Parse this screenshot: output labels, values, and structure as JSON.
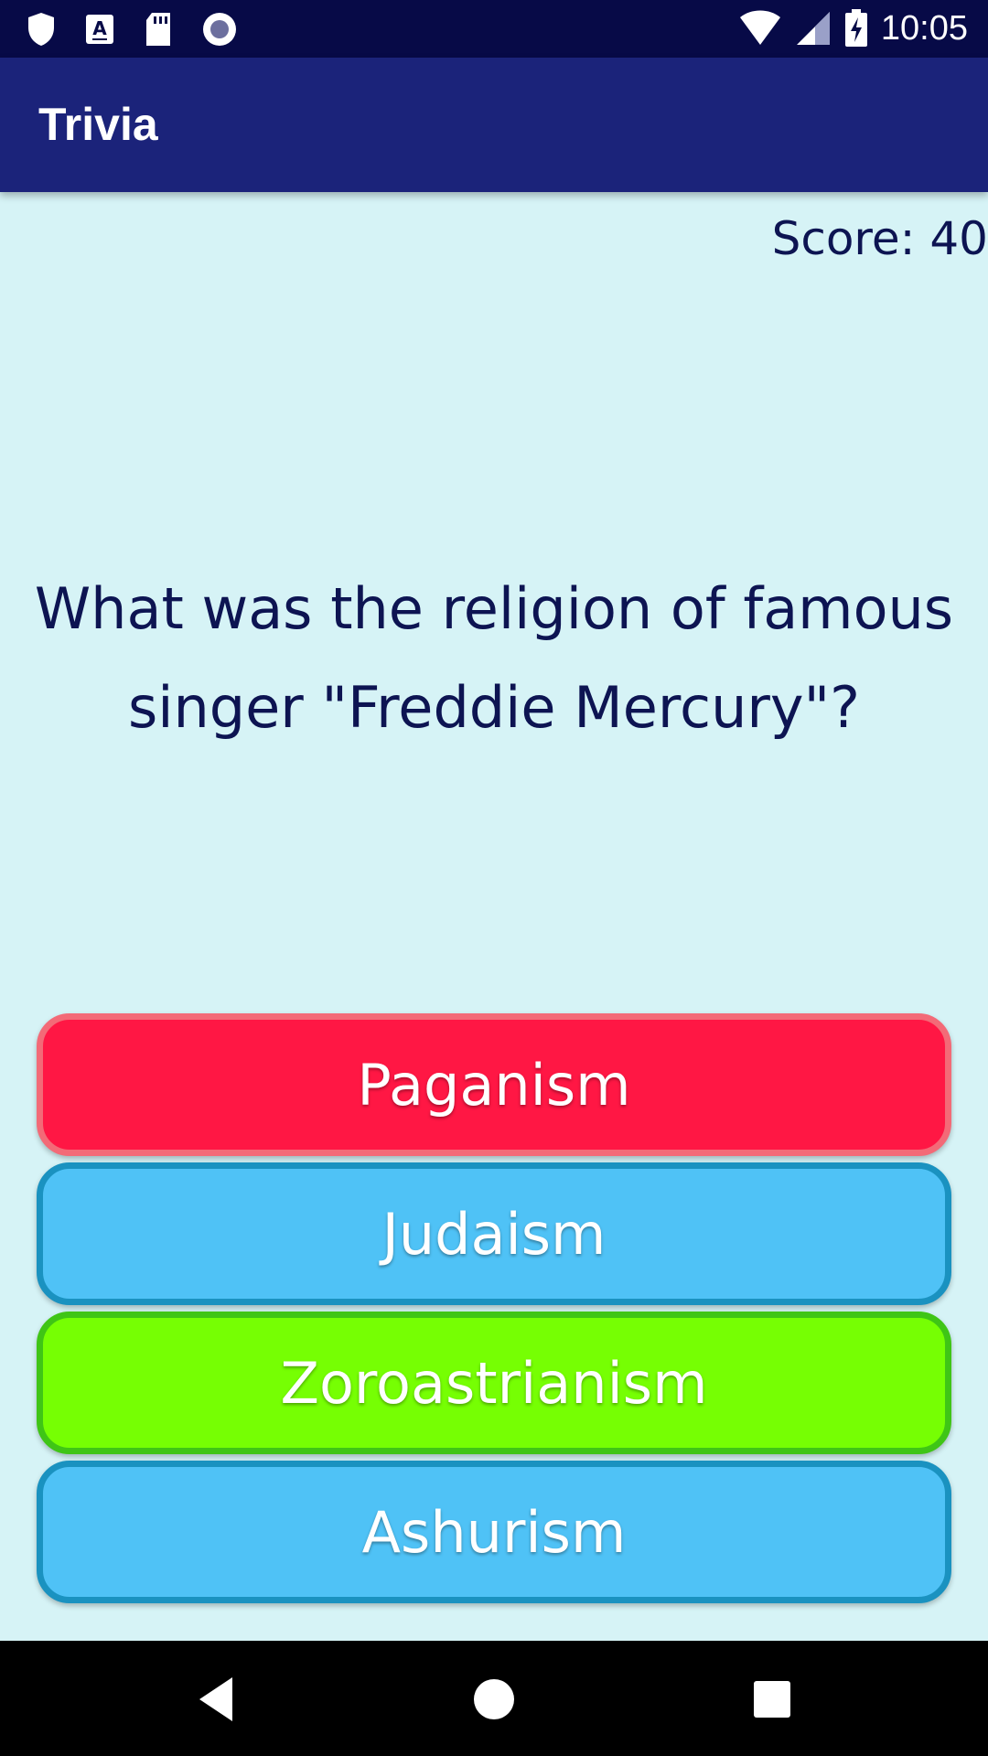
{
  "status_bar": {
    "left_icons": [
      "shield-icon",
      "a-badge-icon",
      "sd-card-icon",
      "record-icon"
    ],
    "right_icons": [
      "wifi-icon",
      "cell-signal-icon",
      "battery-charging-icon"
    ],
    "time": "10:05"
  },
  "app_bar": {
    "title": "Trivia"
  },
  "score": {
    "text": "Score: 40"
  },
  "question": {
    "text": "What was the religion of famous singer \"Freddie Mercury\"?"
  },
  "answers": [
    {
      "label": "Paganism",
      "color": "#ff1744"
    },
    {
      "label": "Judaism",
      "color": "#4fc2f6"
    },
    {
      "label": "Zoroastrianism",
      "color": "#76ff03"
    },
    {
      "label": "Ashurism",
      "color": "#4fc2f6"
    }
  ],
  "nav_bar": {
    "icons": [
      "back-icon",
      "home-icon",
      "recents-icon"
    ]
  },
  "colors": {
    "status_bar": "#070a47",
    "app_bar": "#1b237a",
    "background": "#d6f3f6",
    "text_dark": "#0d1452"
  }
}
